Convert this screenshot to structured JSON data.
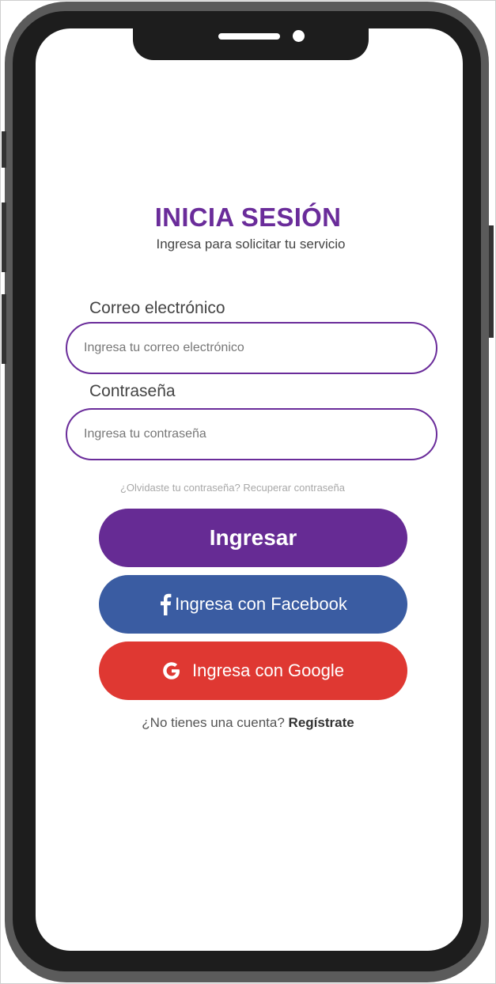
{
  "login": {
    "title": "INICIA SESIÓN",
    "subtitle": "Ingresa para solicitar tu servicio",
    "email": {
      "label": "Correo electrónico",
      "placeholder": "Ingresa tu correo electrónico",
      "value": ""
    },
    "password": {
      "label": "Contraseña",
      "placeholder": "Ingresa tu contraseña",
      "value": ""
    },
    "forgot": {
      "prompt": "¿Olvidaste tu contraseña?",
      "link": "Recuperar contraseña"
    },
    "buttons": {
      "login": "Ingresar",
      "facebook": "Ingresa con Facebook",
      "google": "Ingresa con Google"
    },
    "register": {
      "prompt": "¿No tienes una cuenta?",
      "link": "Regístrate"
    }
  },
  "icons": {
    "facebook": "facebook-icon",
    "google": "google-icon"
  },
  "colors": {
    "primary": "#662b94",
    "title": "#6a2c9a",
    "facebook": "#3a5ca2",
    "google": "#df3832",
    "phone_frame": "#1d1d1d",
    "phone_bezel": "#5b5b5b"
  }
}
